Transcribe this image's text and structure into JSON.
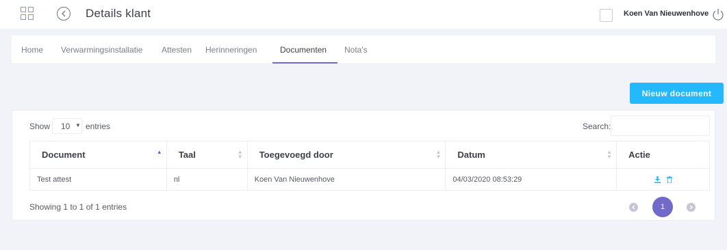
{
  "header": {
    "title": "Details klant",
    "user_name": "Koen Van Nieuwenhove"
  },
  "tabs": [
    {
      "label": "Home",
      "active": false
    },
    {
      "label": "Verwarmingsinstallatie",
      "active": false
    },
    {
      "label": "Attesten",
      "active": false
    },
    {
      "label": "Herinneringen",
      "active": false
    },
    {
      "label": "Documenten",
      "active": true
    },
    {
      "label": "Nota's",
      "active": false
    }
  ],
  "toolbar": {
    "new_document_label": "Nieuw document"
  },
  "datatable": {
    "show_label": "Show",
    "page_length": "10",
    "entries_label": "entries",
    "search_label": "Search:",
    "search_value": "",
    "columns": [
      "Document",
      "Taal",
      "Toegevoegd door",
      "Datum",
      "Actie"
    ],
    "sorted_column": "Document",
    "sort_direction": "ascending",
    "rows": [
      {
        "document": "Test attest",
        "taal": "nl",
        "toegevoegd_door": "Koen Van Nieuwenhove",
        "datum": "04/03/2020 08:53:29",
        "actions": [
          "download-icon",
          "trash-icon"
        ]
      }
    ],
    "info": "Showing 1 to 1 of 1 entries",
    "pagination": {
      "current_page": "1"
    }
  },
  "colors": {
    "accent": "#716aca",
    "primary_button": "#22b9ff",
    "action_icon": "#22b9ff"
  }
}
